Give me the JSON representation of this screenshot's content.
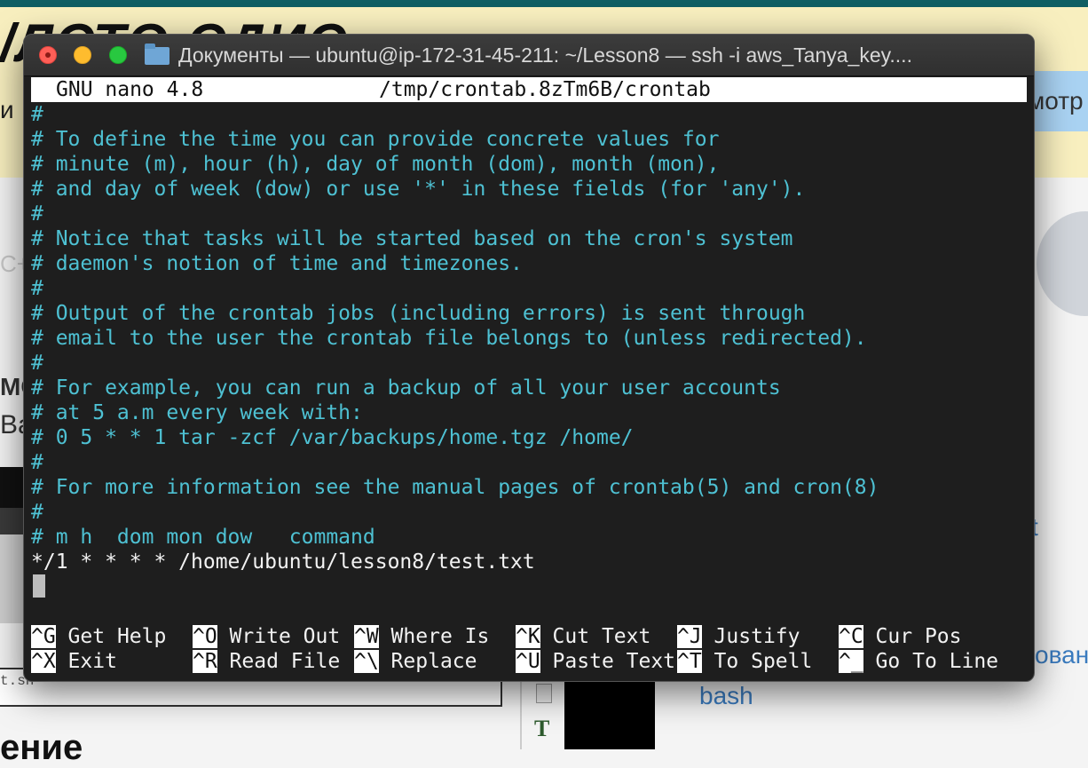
{
  "background": {
    "heading": "/ЛСТО СДИС",
    "frag_i": "и",
    "see_button": "мотр",
    "frag_c": "C+",
    "frag_mo": "МС",
    "frag_va": "Ва",
    "frag_t": "t",
    "file_frag": "t.sh",
    "link_bash": "bash",
    "link_ovan": "ован",
    "bottom_frag": "ение"
  },
  "window": {
    "title": "Документы — ubuntu@ip-172-31-45-211: ~/Lesson8 — ssh -i aws_Tanya_key...."
  },
  "nano": {
    "version": "GNU nano 4.8",
    "file_path": "/tmp/crontab.8zTm6B/crontab",
    "comment_lines": [
      "#",
      "# To define the time you can provide concrete values for",
      "# minute (m), hour (h), day of month (dom), month (mon),",
      "# and day of week (dow) or use '*' in these fields (for 'any').",
      "#",
      "# Notice that tasks will be started based on the cron's system",
      "# daemon's notion of time and timezones.",
      "#",
      "# Output of the crontab jobs (including errors) is sent through",
      "# email to the user the crontab file belongs to (unless redirected).",
      "#",
      "# For example, you can run a backup of all your user accounts",
      "# at 5 a.m every week with:",
      "# 0 5 * * 1 tar -zcf /var/backups/home.tgz /home/",
      "#",
      "# For more information see the manual pages of crontab(5) and cron(8)",
      "#",
      "# m h  dom mon dow   command"
    ],
    "job_line": "*/1 * * * * /home/ubuntu/lesson8/test.txt",
    "shortcuts_row1": [
      {
        "key": "^G",
        "label": " Get Help"
      },
      {
        "key": "^O",
        "label": " Write Out"
      },
      {
        "key": "^W",
        "label": " Where Is"
      },
      {
        "key": "^K",
        "label": " Cut Text"
      },
      {
        "key": "^J",
        "label": " Justify"
      },
      {
        "key": "^C",
        "label": " Cur Pos"
      }
    ],
    "shortcuts_row2": [
      {
        "key": "^X",
        "label": " Exit"
      },
      {
        "key": "^R",
        "label": " Read File"
      },
      {
        "key": "^\\",
        "label": " Replace"
      },
      {
        "key": "^U",
        "label": " Paste Text"
      },
      {
        "key": "^T",
        "label": " To Spell"
      },
      {
        "key": "^_",
        "label": " Go To Line"
      }
    ]
  },
  "colors": {
    "comment": "#4ec1d3",
    "terminal_bg": "#1e1e1e",
    "page_yellow": "#f8efbf"
  }
}
